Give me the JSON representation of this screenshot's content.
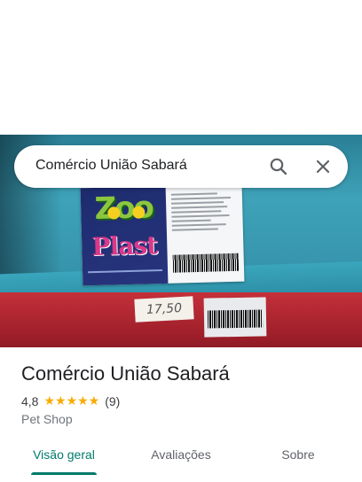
{
  "search": {
    "query": "Comércio União Sabará"
  },
  "photo": {
    "price_tag": "17,50"
  },
  "place": {
    "name": "Comércio União Sabará",
    "rating": "4,8",
    "stars": "★★★★★",
    "review_count": "(9)",
    "category": "Pet Shop"
  },
  "tabs": [
    {
      "label": "Visão geral",
      "active": true
    },
    {
      "label": "Avaliações",
      "active": false
    },
    {
      "label": "Sobre",
      "active": false
    }
  ],
  "colors": {
    "accent": "#00796b",
    "star": "#f9ab00",
    "title_text": "#202124",
    "secondary_text": "#70757a"
  },
  "icons": [
    "search-icon",
    "close-icon"
  ]
}
